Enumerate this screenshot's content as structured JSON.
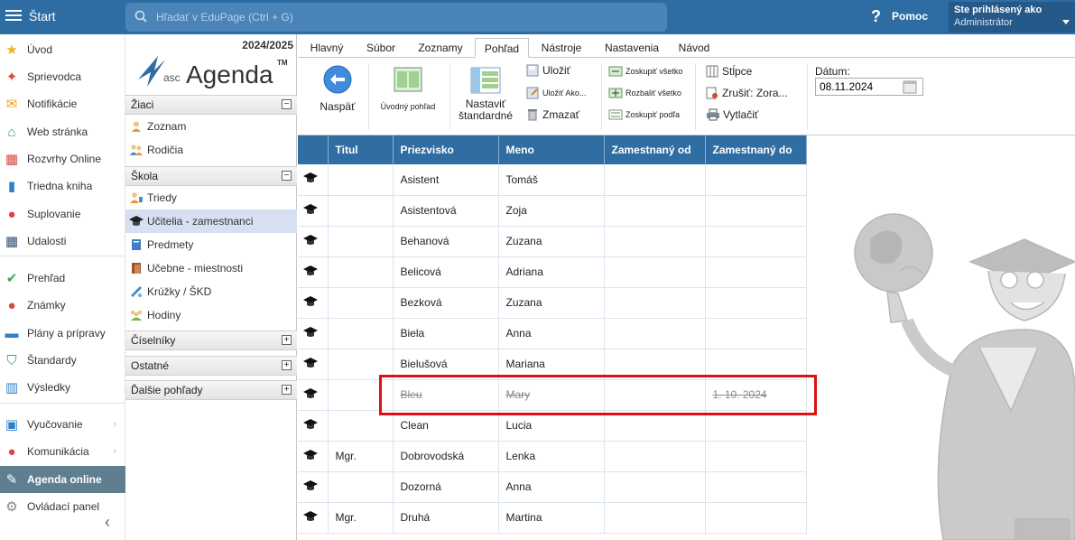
{
  "topbar": {
    "start_label": "Štart",
    "search_placeholder": "Hľadať v EduPage (Ctrl + G)",
    "help_label": "Pomoc",
    "login_line1": "Ste prihlásený ako",
    "login_line2": "Administrátor"
  },
  "sidebar": {
    "items": [
      {
        "label": "Úvod",
        "icon": "star-icon",
        "color": "#f2b01e"
      },
      {
        "label": "Sprievodca",
        "icon": "wand-icon",
        "color": "#e0452f"
      },
      {
        "label": "Notifikácie",
        "icon": "envelope-icon",
        "color": "#f0a020"
      },
      {
        "label": "Web stránka",
        "icon": "home-icon",
        "color": "#2c9a6b"
      },
      {
        "label": "Rozvrhy Online",
        "icon": "grid-icon",
        "color": "#d9463a"
      },
      {
        "label": "Triedna kniha",
        "icon": "book-icon",
        "color": "#2e80c8"
      },
      {
        "label": "Suplovanie",
        "icon": "person-icon",
        "color": "#d9463a"
      },
      {
        "label": "Udalosti",
        "icon": "calendar-icon",
        "color": "#2c4d6f"
      },
      {
        "label": "Prehľad",
        "icon": "check-icon",
        "color": "#3aaa4a"
      },
      {
        "label": "Známky",
        "icon": "grade-icon",
        "color": "#d9463a"
      },
      {
        "label": "Plány a prípravy",
        "icon": "briefcase-icon",
        "color": "#2e80c8"
      },
      {
        "label": "Štandardy",
        "icon": "shield-icon",
        "color": "#3aaa4a"
      },
      {
        "label": "Výsledky",
        "icon": "bar-chart-icon",
        "color": "#2e80c8"
      },
      {
        "label": "Vyučovanie",
        "icon": "board-icon",
        "color": "#2e80c8"
      },
      {
        "label": "Komunikácia",
        "icon": "chat-icon",
        "color": "#d9463a"
      },
      {
        "label": "Agenda online",
        "icon": "pen-icon",
        "color": "#ffffff"
      },
      {
        "label": "Ovládací panel",
        "icon": "gear-icon",
        "color": "#888888"
      }
    ]
  },
  "agenda": {
    "year": "2024/2025",
    "logo_prefix": "asc",
    "logo_main": "Agenda",
    "logo_tm": "TM",
    "sections": {
      "ziaci": "Žiaci",
      "skola": "Škola",
      "ciselniky": "Číselníky",
      "ostatne": "Ostatné",
      "dalsie": "Ďalšie pohľady"
    },
    "ziaci_items": [
      "Zoznam",
      "Rodičia"
    ],
    "skola_items": [
      "Triedy",
      "Učitelia - zamestnanci",
      "Predmety",
      "Učebne - miestnosti",
      "Krúžky / ŠKD",
      "Hodiny"
    ]
  },
  "ribbon": {
    "tabs": [
      "Hlavný",
      "Súbor",
      "Zoznamy",
      "Pohľad",
      "Nástroje",
      "Nastavenia",
      "Návod"
    ],
    "back": "Naspäť",
    "home_view": "Úvodný pohľad",
    "set_default_1": "Nastaviť",
    "set_default_2": "štandardné",
    "save": "Uložiť",
    "save_as": "Uložiť Ako...",
    "delete": "Zmazať",
    "group_all": "Zoskupiť všetko",
    "expand_all": "Rozbaliť všetko",
    "group_by": "Zoskupiť podľa",
    "columns": "Stĺpce",
    "cancel_sort": "Zrušiť: Zora...",
    "print": "Vytlačiť",
    "date_label": "Dátum:",
    "date_value": "08.11.2024"
  },
  "table": {
    "headers": [
      "Titul",
      "Priezvisko",
      "Meno",
      "Zamestnaný od",
      "Zamestnaný do"
    ],
    "rows": [
      {
        "titul": "",
        "priezvisko": "Asistent",
        "meno": "Tomáš",
        "od": "",
        "do": ""
      },
      {
        "titul": "",
        "priezvisko": "Asistentová",
        "meno": "Zoja",
        "od": "",
        "do": ""
      },
      {
        "titul": "",
        "priezvisko": "Behanová",
        "meno": "Zuzana",
        "od": "",
        "do": ""
      },
      {
        "titul": "",
        "priezvisko": "Belicová",
        "meno": "Adriana",
        "od": "",
        "do": ""
      },
      {
        "titul": "",
        "priezvisko": "Bezková",
        "meno": "Zuzana",
        "od": "",
        "do": ""
      },
      {
        "titul": "",
        "priezvisko": "Biela",
        "meno": "Anna",
        "od": "",
        "do": ""
      },
      {
        "titul": "",
        "priezvisko": "Bielušová",
        "meno": "Mariana",
        "od": "",
        "do": ""
      },
      {
        "titul": "",
        "priezvisko": "Bleu",
        "meno": "Mary",
        "od": "",
        "do": "1. 10. 2024"
      },
      {
        "titul": "",
        "priezvisko": "Clean",
        "meno": "Lucia",
        "od": "",
        "do": ""
      },
      {
        "titul": "Mgr.",
        "priezvisko": "Dobrovodská",
        "meno": "Lenka",
        "od": "",
        "do": ""
      },
      {
        "titul": "",
        "priezvisko": "Dozorná",
        "meno": "Anna",
        "od": "",
        "do": ""
      },
      {
        "titul": "Mgr.",
        "priezvisko": "Druhá",
        "meno": "Martina",
        "od": "",
        "do": ""
      }
    ]
  },
  "colors": {
    "topbar": "#2e6da4",
    "table_header": "#2f6da3",
    "highlight": "#e01010",
    "active_nav": "#5f7f90"
  }
}
